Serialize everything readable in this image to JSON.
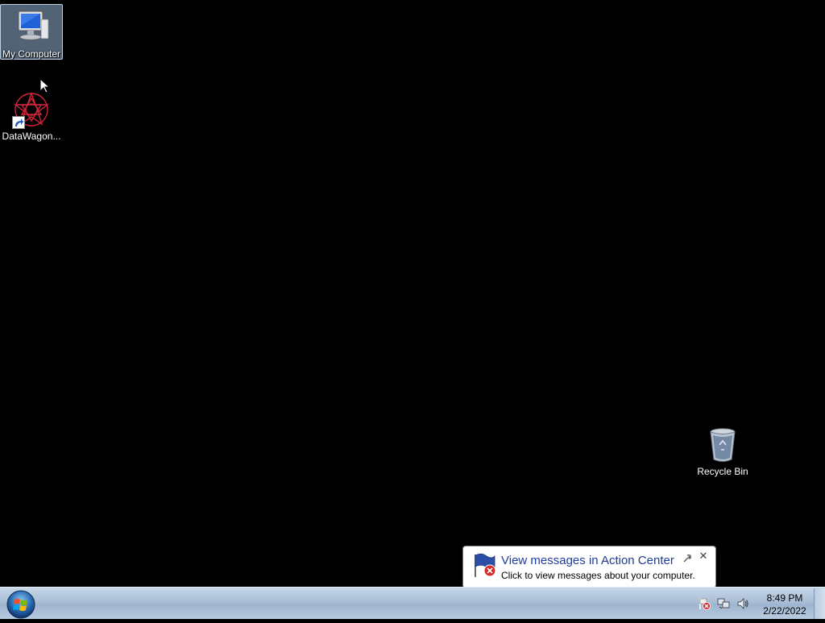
{
  "desktop": {
    "icons": [
      {
        "label": "My Computer",
        "icon": "computer-icon",
        "selected": true
      },
      {
        "label": "DataWagon...",
        "icon": "datawagon-app-icon",
        "shortcut": true
      },
      {
        "label": "Recycle Bin",
        "icon": "recycle-bin-icon"
      }
    ]
  },
  "balloon": {
    "title": "View messages in Action Center",
    "text": "Click to view messages about your computer.",
    "close_glyph": "✕",
    "icon": "action-center-flag-icon"
  },
  "taskbar": {
    "start_icon": "windows-logo-icon",
    "tray": [
      "action-center-icon",
      "network-icon",
      "volume-icon"
    ],
    "clock": {
      "time": "8:49 PM",
      "date": "2/22/2022"
    }
  },
  "colors": {
    "desktop_bg": "#000000",
    "taskbar": "#a9bed6",
    "balloon_title": "#1e3c9a"
  }
}
